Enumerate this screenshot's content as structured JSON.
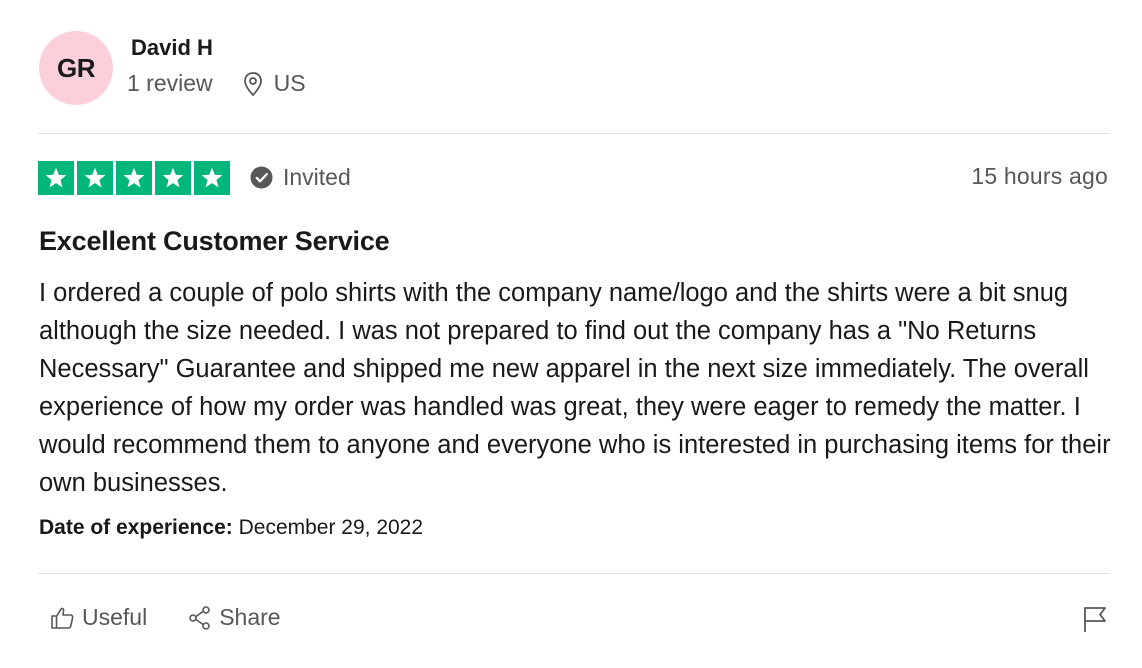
{
  "reviewer": {
    "initials": "GR",
    "name": "David H",
    "review_count": "1 review",
    "location": "US"
  },
  "rating": {
    "stars": 5,
    "max_stars": 5,
    "star_color": "#00b67a",
    "status": "Invited",
    "timestamp": "15 hours ago"
  },
  "review": {
    "title": "Excellent Customer Service",
    "text": "I ordered a couple of polo shirts with the company name/logo and the shirts were a bit snug although the size needed. I was not prepared to find out the company has a \"No Returns Necessary\" Guarantee and shipped me new apparel in the next size immediately. The overall experience of how my order was handled was great, they were eager to remedy the matter. I would recommend them to anyone and everyone who is interested in purchasing items for their own businesses.",
    "experience_label": "Date of experience:",
    "experience_date": "December 29, 2022"
  },
  "actions": {
    "useful_label": "Useful",
    "share_label": "Share"
  },
  "colors": {
    "avatar_bg": "#fcd0db",
    "muted_text": "#575757",
    "divider": "#e0e0e0"
  },
  "icons": {
    "location": "location-pin-icon",
    "invited": "check-circle-icon",
    "useful": "thumbs-up-icon",
    "share": "share-icon",
    "report": "flag-icon"
  }
}
